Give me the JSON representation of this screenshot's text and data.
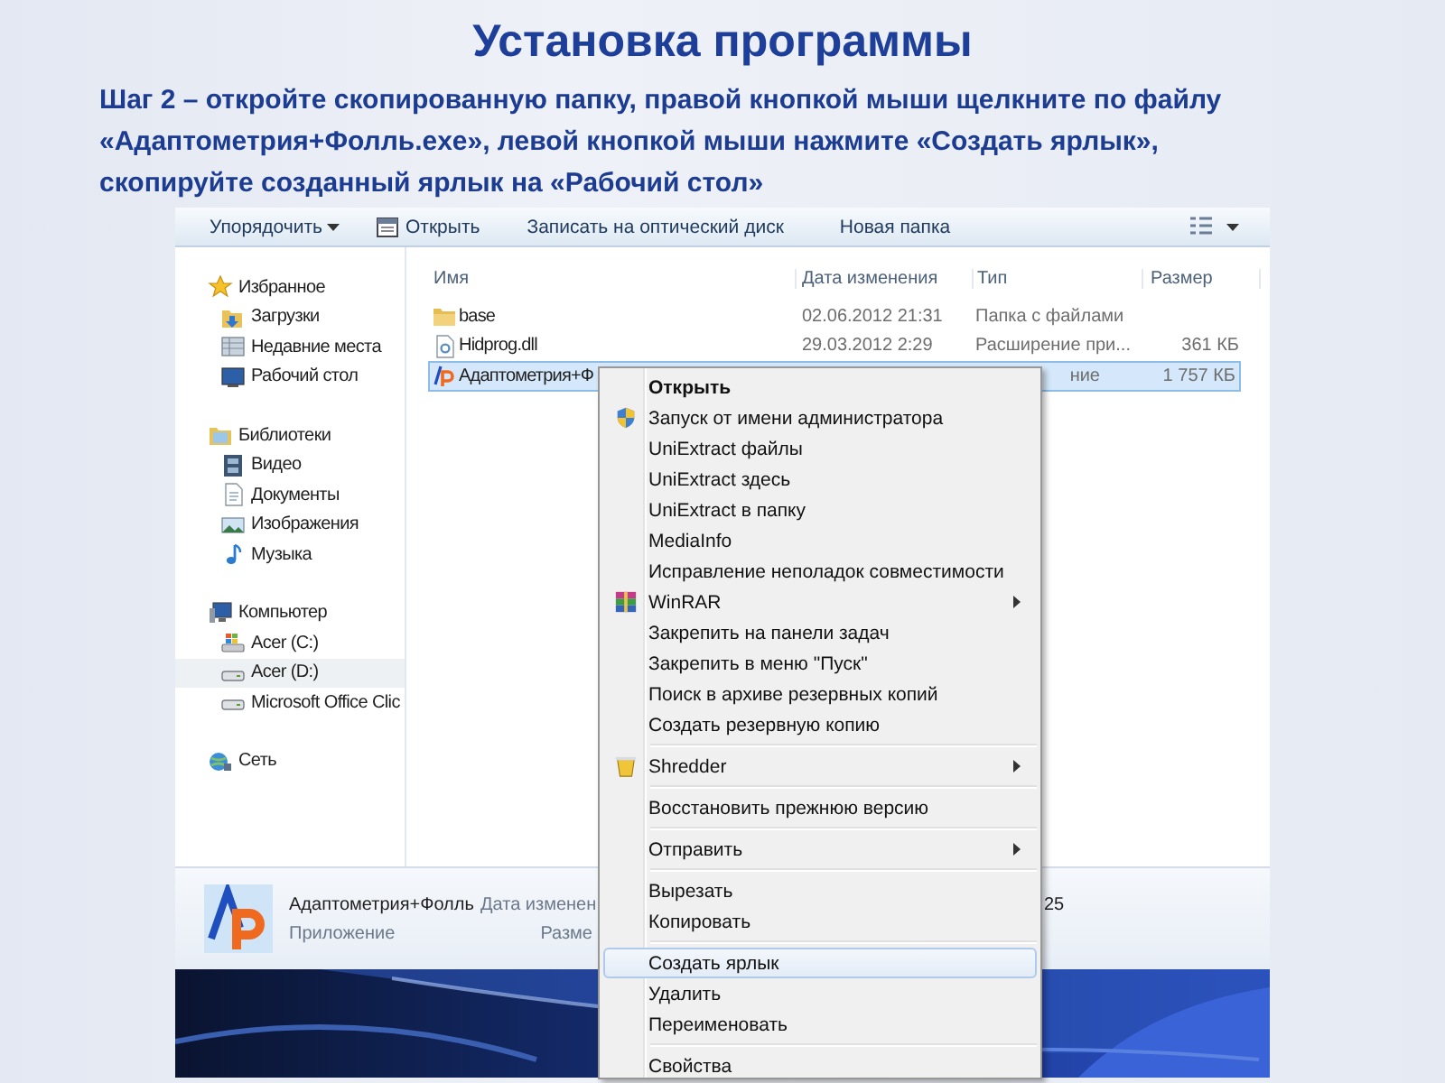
{
  "slide": {
    "title": "Установка программы",
    "instructions": "Шаг 2 – откройте скопированную папку, правой кнопкой мыши щелкните по файлу\n«Адаптометрия+Фолль.exe», левой кнопкой мыши нажмите «Создать ярлык»,\nскопируйте созданный ярлык на «Рабочий стол»"
  },
  "toolbar": {
    "items": [
      {
        "label": "Упорядочить",
        "kind": "dropdown"
      },
      {
        "label": "Открыть",
        "kind": "open"
      },
      {
        "label": "Записать на оптический диск",
        "kind": "plain"
      },
      {
        "label": "Новая папка",
        "kind": "plain"
      }
    ]
  },
  "navigation": [
    {
      "label": "Избранное",
      "kind": "star",
      "selected": false,
      "children": [
        {
          "label": "Загрузки",
          "kind": "downloads",
          "selected": false
        },
        {
          "label": "Недавние места",
          "kind": "recent",
          "selected": false
        },
        {
          "label": "Рабочий стол",
          "kind": "desktop",
          "selected": false
        }
      ]
    },
    {
      "label": "Библиотеки",
      "kind": "library",
      "selected": false,
      "children": [
        {
          "label": "Видео",
          "kind": "video",
          "selected": false
        },
        {
          "label": "Документы",
          "kind": "document",
          "selected": false
        },
        {
          "label": "Изображения",
          "kind": "pictures",
          "selected": false
        },
        {
          "label": "Музыка",
          "kind": "music",
          "selected": false
        }
      ]
    },
    {
      "label": "Компьютер",
      "kind": "computer",
      "selected": false,
      "children": [
        {
          "label": "Acer (C:)",
          "kind": "system-drive",
          "selected": false
        },
        {
          "label": "Acer (D:)",
          "kind": "drive",
          "selected": true
        },
        {
          "label": "Microsoft Office Clic",
          "kind": "drive",
          "selected": false
        }
      ]
    },
    {
      "label": "Сеть",
      "kind": "network",
      "selected": false
    }
  ],
  "columns": [
    "Имя",
    "Дата изменения",
    "Тип",
    "Размер"
  ],
  "files": [
    {
      "name": "base",
      "date": "02.06.2012 21:31",
      "type": "Папка с файлами",
      "kind": "folder",
      "selected": false
    },
    {
      "name": "Hidprog.dll",
      "date": "29.03.2012 2:29",
      "type": "Расширение при...",
      "size": "361 КБ",
      "kind": "dll",
      "selected": false
    },
    {
      "name": "Адаптометрия+Ф",
      "type": "ние",
      "size": "1 757 КБ",
      "kind": "app",
      "selected": true
    }
  ],
  "details": {
    "name": "Адаптометрия+Фолль",
    "type": "Приложение",
    "date_label": "Дата изменен",
    "size_label": "Разме",
    "date_value": "25"
  },
  "context_menu": [
    {
      "kind": "item",
      "label": "Открыть",
      "bold": true,
      "selected": false
    },
    {
      "kind": "admin",
      "label": "Запуск от имени администратора",
      "selected": false
    },
    {
      "kind": "item",
      "label": "UniExtract файлы",
      "selected": false
    },
    {
      "kind": "item",
      "label": "UniExtract здесь",
      "selected": false
    },
    {
      "kind": "item",
      "label": "UniExtract в папку",
      "selected": false
    },
    {
      "kind": "item",
      "label": "MediaInfo",
      "selected": false
    },
    {
      "kind": "item",
      "label": "Исправление неполадок совместимости",
      "selected": false
    },
    {
      "kind": "archiver",
      "label": "WinRAR",
      "submenu": true,
      "selected": false
    },
    {
      "kind": "item",
      "label": "Закрепить на панели задач",
      "selected": false
    },
    {
      "kind": "item",
      "label": "Закрепить в меню \"Пуск\"",
      "selected": false
    },
    {
      "kind": "item",
      "label": "Поиск в архиве резервных копий",
      "selected": false
    },
    {
      "kind": "item",
      "label": "Создать резервную копию",
      "selected": false
    },
    {
      "kind": "separator"
    },
    {
      "kind": "shredder",
      "label": "Shredder",
      "submenu": true,
      "selected": false
    },
    {
      "kind": "separator"
    },
    {
      "kind": "item",
      "label": "Восстановить прежнюю версию",
      "selected": false
    },
    {
      "kind": "separator"
    },
    {
      "kind": "item",
      "label": "Отправить",
      "submenu": true,
      "selected": false
    },
    {
      "kind": "separator"
    },
    {
      "kind": "item",
      "label": "Вырезать",
      "selected": false
    },
    {
      "kind": "item",
      "label": "Копировать",
      "selected": false
    },
    {
      "kind": "separator"
    },
    {
      "kind": "item",
      "label": "Создать ярлык",
      "selected": true
    },
    {
      "kind": "item",
      "label": "Удалить",
      "selected": false
    },
    {
      "kind": "item",
      "label": "Переименовать",
      "selected": false
    },
    {
      "kind": "separator"
    },
    {
      "kind": "item",
      "label": "Свойства",
      "selected": false
    }
  ]
}
